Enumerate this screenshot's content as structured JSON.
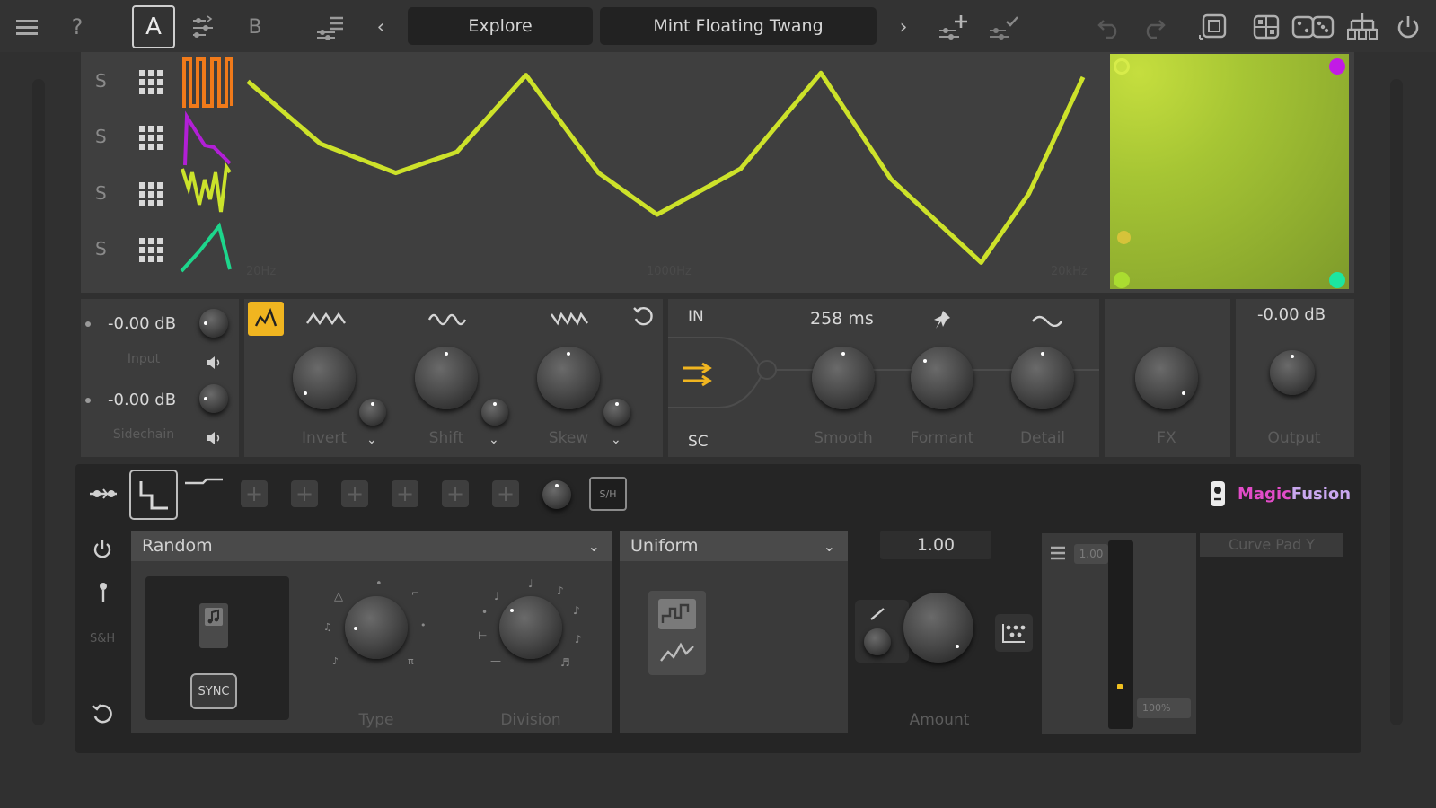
{
  "topbar": {
    "a_label": "A",
    "b_label": "B",
    "prev_label": "‹",
    "next_label": "›",
    "bank_label": "Explore",
    "preset_name": "Mint Floating Twang"
  },
  "sources": [
    {
      "label": "S",
      "color": "#f07a1a"
    },
    {
      "label": "S",
      "color": "#b21fd6"
    },
    {
      "label": "S",
      "color": "#cbe32b"
    },
    {
      "label": "S",
      "color": "#1dd68c"
    }
  ],
  "wave": {
    "color": "#cde22a",
    "points": [
      [
        0.0,
        0.08
      ],
      [
        0.087,
        0.38
      ],
      [
        0.177,
        0.52
      ],
      [
        0.25,
        0.42
      ],
      [
        0.333,
        0.05
      ],
      [
        0.42,
        0.52
      ],
      [
        0.49,
        0.72
      ],
      [
        0.59,
        0.5
      ],
      [
        0.686,
        0.04
      ],
      [
        0.77,
        0.55
      ],
      [
        0.878,
        0.95
      ],
      [
        0.935,
        0.62
      ],
      [
        1.0,
        0.06
      ]
    ],
    "freq_labels": [
      "20Hz",
      "1000Hz",
      "20kHz"
    ]
  },
  "xy_pad": {
    "corner_colors": [
      "#d7ec4a",
      "#c21be6",
      "#aadd30",
      "#1ce6a0"
    ],
    "mid_dot_color": "#d6c33a"
  },
  "io": {
    "input_db": "-0.00 dB",
    "input_label": "Input",
    "sidechain_db": "-0.00 dB",
    "sidechain_label": "Sidechain"
  },
  "shaper": {
    "knobs": [
      "Invert",
      "Shift",
      "Skew"
    ]
  },
  "routing": {
    "in_label": "IN",
    "sc_label": "SC",
    "smooth_value": "258 ms",
    "knobs": [
      "Smooth",
      "Formant",
      "Detail"
    ]
  },
  "fx": {
    "label": "FX"
  },
  "output": {
    "db": "-0.00 dB",
    "label": "Output"
  },
  "mod": {
    "brand": "MagicFusion",
    "brand_prefix": "Magic",
    "brand_suffix": "Fusion",
    "sh_tab": "S/H",
    "sh_label": "S&H",
    "mode": "Random",
    "distribution": "Uniform",
    "amount_value": "1.00",
    "amount_label": "Amount",
    "type_label": "Type",
    "division_label": "Division",
    "sync_label": "SYNC",
    "mini_value": "1.00",
    "mini_pct": "100%",
    "curve_label": "Curve Pad Y",
    "meter_level": 0.2
  }
}
